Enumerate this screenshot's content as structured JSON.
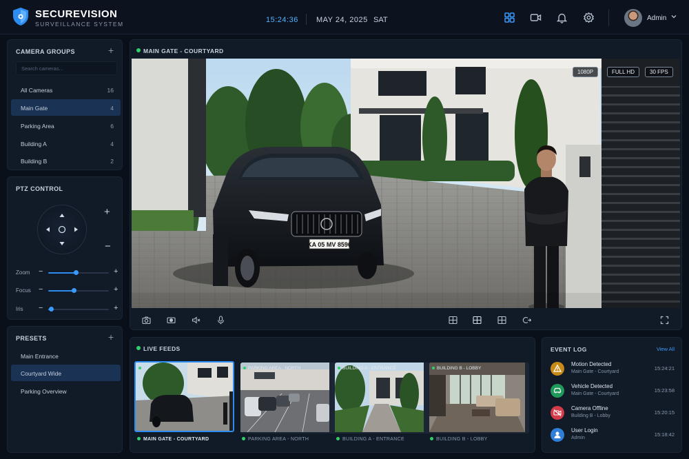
{
  "brand": {
    "title": "SECUREVISION",
    "subtitle": "SURVEILLANCE SYSTEM"
  },
  "header": {
    "time": "15:24:36",
    "date": "MAY 24, 2025",
    "day": "SAT",
    "user": "Admin"
  },
  "camera_groups": {
    "title": "CAMERA GROUPS",
    "search_placeholder": "Search cameras...",
    "items": [
      {
        "label": "All Cameras",
        "count": "16"
      },
      {
        "label": "Main Gate",
        "count": "4"
      },
      {
        "label": "Parking Area",
        "count": "6"
      },
      {
        "label": "Building A",
        "count": "4"
      },
      {
        "label": "Building B",
        "count": "2"
      }
    ]
  },
  "ptz": {
    "title": "PTZ CONTROL",
    "sliders": [
      {
        "label": "Zoom",
        "value": 0.45
      },
      {
        "label": "Focus",
        "value": 0.42
      },
      {
        "label": "Iris",
        "value": 0.05
      }
    ]
  },
  "presets": {
    "title": "PRESETS",
    "items": [
      "Main Entrance",
      "Courtyard Wide",
      "Parking Overview"
    ]
  },
  "main_feed": {
    "title": "MAIN GATE - COURTYARD",
    "badges": [
      "1080P",
      "FULL HD",
      "30 FPS"
    ],
    "plate": "KA 05 MV 8596"
  },
  "live_feeds": {
    "title": "LIVE FEEDS",
    "feeds": [
      {
        "tag": "",
        "caption": "MAIN GATE - COURTYARD"
      },
      {
        "tag": "PARKING AREA - NORTH",
        "caption": "PARKING AREA - NORTH"
      },
      {
        "tag": "BUILDING A - ENTRANCE",
        "caption": "BUILDING A - ENTRANCE"
      },
      {
        "tag": "BUILDING B - LOBBY",
        "caption": "BUILDING B - LOBBY"
      }
    ]
  },
  "event_log": {
    "title": "EVENT LOG",
    "view_all": "View All",
    "events": [
      {
        "title": "Motion Detected",
        "sub": "Main Gate - Courtyard",
        "time": "15:24:21",
        "color": "#c88a16",
        "icon": "warning-icon"
      },
      {
        "title": "Vehicle Detected",
        "sub": "Main Gate - Courtyard",
        "time": "15:23:58",
        "color": "#1f9a5a",
        "icon": "car-icon"
      },
      {
        "title": "Camera Offline",
        "sub": "Building B - Lobby",
        "time": "15:20:15",
        "color": "#d23b48",
        "icon": "camera-off-icon"
      },
      {
        "title": "User Login",
        "sub": "Admin",
        "time": "15:18:42",
        "color": "#2f7ed8",
        "icon": "user-icon"
      }
    ]
  },
  "colors": {
    "accent": "#2d8cf0",
    "live": "#32d06a",
    "panel": "#111a27",
    "background": "#0a1019"
  }
}
